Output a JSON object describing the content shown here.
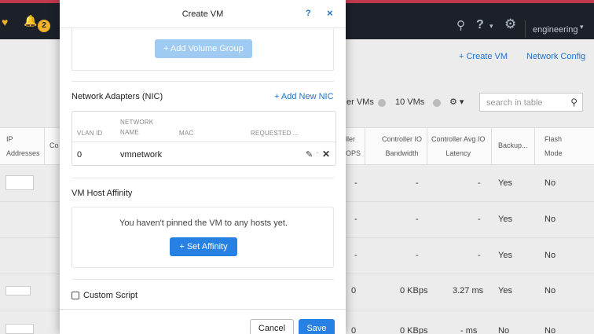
{
  "topbar": {
    "alert_count": "2",
    "user_name": "engineering"
  },
  "background": {
    "create_vm_link": "+ Create VM",
    "network_config_link": "Network Config",
    "filter_vms_text": "er VMs",
    "vm_count_text": "10 VMs",
    "search_placeholder": "search in table",
    "table_headers": {
      "ip": "IP\nAddresses",
      "co": "Co",
      "ops": "ller\nOPS",
      "ctrl_io_bw": "Controller IO\nBandwidth",
      "ctrl_io_lat": "Controller Avg IO\nLatency",
      "backup": "Backup...",
      "flash": "Flash\nMode"
    },
    "rows": [
      {
        "ops": "-",
        "bw": "-",
        "lat": "-",
        "backup": "Yes",
        "flash": "No"
      },
      {
        "ops": "-",
        "bw": "-",
        "lat": "-",
        "backup": "Yes",
        "flash": "No"
      },
      {
        "ops": "-",
        "bw": "-",
        "lat": "-",
        "backup": "Yes",
        "flash": "No"
      },
      {
        "ops": "0",
        "bw": "0 KBps",
        "lat": "3.27 ms",
        "backup": "Yes",
        "flash": "No"
      },
      {
        "ops": "0",
        "bw": "0 KBps",
        "lat": "- ms",
        "backup": "No",
        "flash": "No"
      }
    ]
  },
  "modal": {
    "title": "Create VM",
    "help": "?",
    "close": "×",
    "add_volume_group": "+ Add Volume Group",
    "network_adapters_title": "Network Adapters (NIC)",
    "add_new_nic": "+ Add New NIC",
    "nic_headers": {
      "vlan": "VLAN ID",
      "network_name": "NETWORK\nNAME",
      "mac": "MAC",
      "requested": "REQUESTED ..."
    },
    "nic_row": {
      "vlan": "0",
      "network_name": "vmnetwork"
    },
    "vm_host_affinity_title": "VM Host Affinity",
    "affinity_message": "You haven't pinned the VM to any hosts yet.",
    "set_affinity": "+ Set Affinity",
    "custom_script": "Custom Script",
    "cancel": "Cancel",
    "save": "Save"
  },
  "colors": {
    "accent": "#2780e3",
    "link": "#2272c8",
    "topbar": "#1c2028",
    "alert": "#f0b229"
  }
}
